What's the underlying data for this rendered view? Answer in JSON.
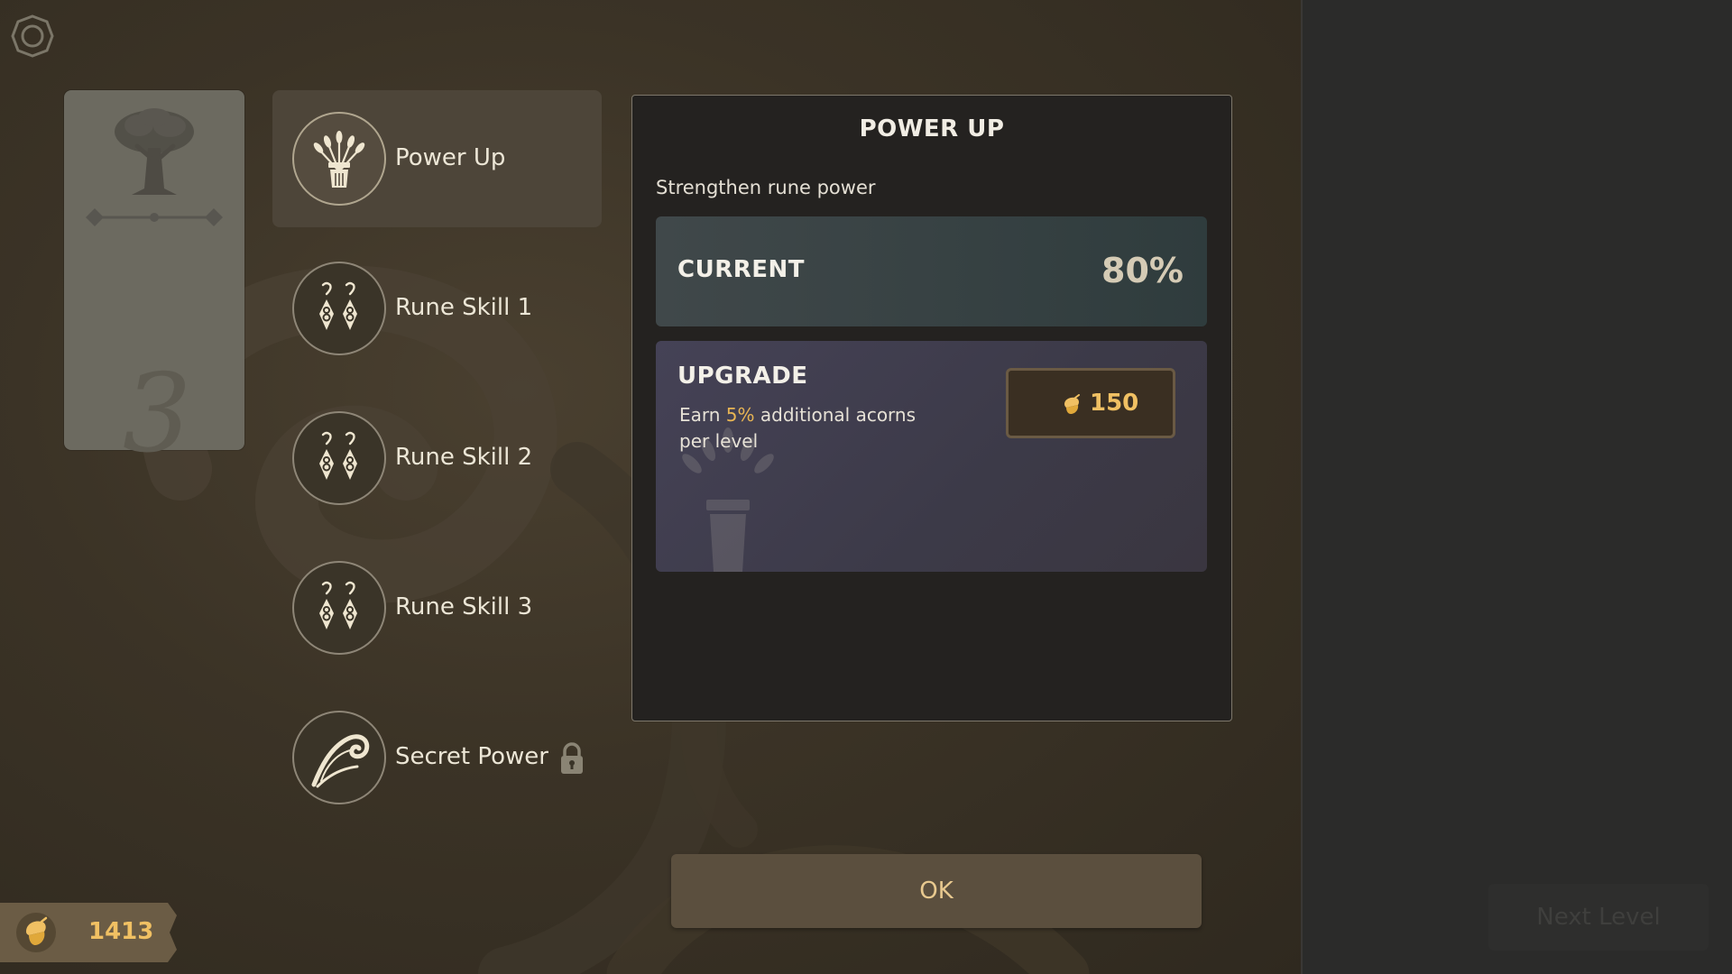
{
  "level_card": {
    "level_number": "3"
  },
  "skills": [
    {
      "label": "Power Up",
      "icon": "wheat-bundle-icon",
      "selected": true,
      "locked": false
    },
    {
      "label": "Rune Skill 1",
      "icon": "rune-drops-icon",
      "selected": false,
      "locked": false
    },
    {
      "label": "Rune Skill 2",
      "icon": "rune-drops-icon",
      "selected": false,
      "locked": false
    },
    {
      "label": "Rune Skill 3",
      "icon": "rune-drops-icon",
      "selected": false,
      "locked": false
    },
    {
      "label": "Secret Power",
      "icon": "wind-swirl-icon",
      "selected": false,
      "locked": true
    }
  ],
  "detail": {
    "title": "POWER UP",
    "subtitle": "Strengthen rune power",
    "current_label": "CURRENT",
    "current_value": "80%",
    "upgrade_label": "UPGRADE",
    "upgrade_desc_prefix": "Earn ",
    "upgrade_desc_highlight": "5%",
    "upgrade_desc_suffix": " additional acorns per level",
    "upgrade_cost": "150"
  },
  "ok_button": {
    "label": "OK"
  },
  "currency": {
    "amount": "1413",
    "icon": "acorn-icon"
  },
  "next_level_button": {
    "label": "Next Level"
  },
  "colors": {
    "accent_gold": "#f0c063",
    "highlight": "#e8b554",
    "panel_bg": "#242220",
    "current_bg": "#2f3c3d",
    "upgrade_bg": "#454256"
  }
}
